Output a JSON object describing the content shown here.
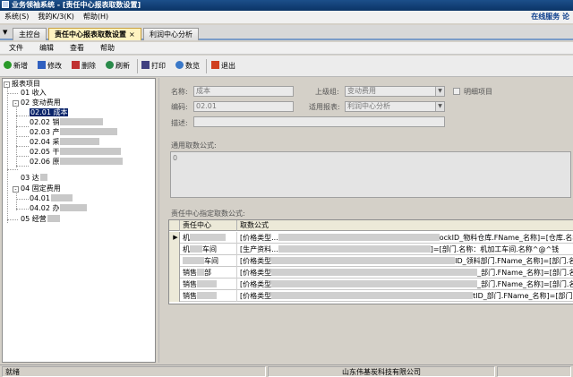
{
  "window": {
    "title": "业务领袖系统 - [责任中心报表取数设置]"
  },
  "sysmenu": {
    "items": [
      "系统(S)",
      "我的K/3(K)",
      "帮助(H)"
    ],
    "online": "在线服务  论"
  },
  "tabs": {
    "drop_icon": "▼",
    "main": "主控台",
    "active": "责任中心报表取数设置",
    "close": "×",
    "analysis": "利润中心分析"
  },
  "menubar": {
    "items": [
      "文件",
      "编辑",
      "查看",
      "帮助"
    ]
  },
  "toolbar": {
    "new": "新增",
    "edit": "修改",
    "delete": "删除",
    "refresh": "刷新",
    "print": "打印",
    "preview": "数览",
    "exit": "退出",
    "colors": {
      "new": "#2a9a2a",
      "edit": "#3060c0",
      "delete": "#c03030",
      "refresh": "#2a8a4a",
      "print": "#404080",
      "preview": "#3a78c8",
      "exit": "#d04020"
    }
  },
  "tree": {
    "root": "报表项目",
    "n01": "01 收入",
    "n02": "02 变动费用",
    "n0201": "02.01 成本",
    "n0202": "02.02 销",
    "n0203": "02.03 产",
    "n0204": "02.04 采",
    "n0205": "02.05 干",
    "n0206": "02.06 原",
    "n03": "03 达",
    "n04": "04 固定费用",
    "n0401": "04.01",
    "n0402": "04.02 办",
    "n05": "05 经营",
    "expand": "-",
    "collapse": "+"
  },
  "form": {
    "name_label": "名称:",
    "name_value": "成本",
    "parent_label": "上级组:",
    "parent_value": "变动费用",
    "detail_label": "明细项目",
    "code_label": "编码:",
    "code_value": "02.01",
    "report_label": "适用报表:",
    "report_value": "利润中心分析",
    "desc_label": "描述:",
    "desc_value": "",
    "general_formula_label": "通用取数公式:",
    "general_formula_value": "0",
    "center_formula_label": "责任中心指定取数公式:",
    "dd_icon": "▼"
  },
  "grid": {
    "headers": [
      "责任中心",
      "取数公式"
    ],
    "current_marker": "▶",
    "rows": [
      {
        "center": "机",
        "formula": "[价格类型...",
        "tail": "ockID_物料仓库.FName_名称]=[仓库.名称"
      },
      {
        "center": "机",
        "center2": "车间",
        "formula": "[生产资料...",
        "tail": "]=[部门.名称：机加工车间.名称^@^钱"
      },
      {
        "center": "",
        "center2": "车间",
        "formula": "[价格类型",
        "tail": "ID_领料部门.FName_名称]=[部门.名称"
      },
      {
        "center": "销售",
        "center2": "部",
        "formula": "[价格类型",
        "tail": "_部门.FName_名称]=[部门.名称：销售一"
      },
      {
        "center": "销售",
        "formula": "[价格类型",
        "tail": "_部门.FName_名称]=[部门.名称：销售三"
      },
      {
        "center": "销售",
        "formula": "[价格类型",
        "tail": "tID_部门.FName_名称]=[部门.名称：销售"
      }
    ]
  },
  "status": {
    "left": "就绪",
    "center": "山东伟基炭科技有限公司"
  }
}
